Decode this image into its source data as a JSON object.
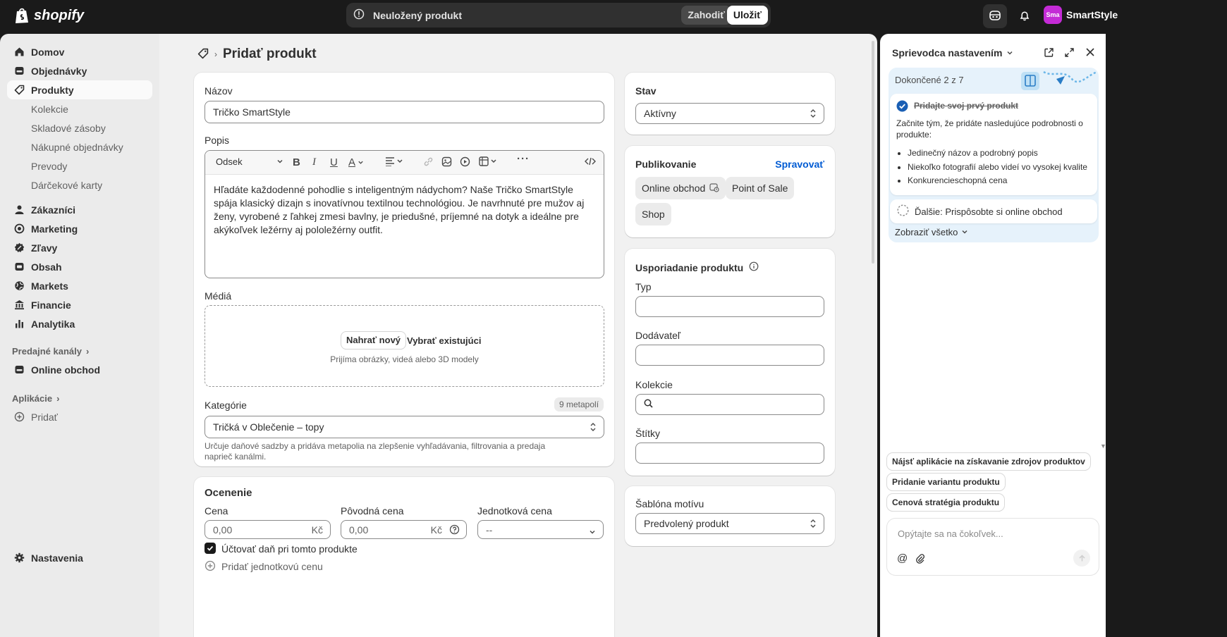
{
  "topbar": {
    "brand": "shopify",
    "unsaved_label": "Neuložený produkt",
    "discard_label": "Zahodiť",
    "save_label": "Uložiť",
    "store_initials": "Sma",
    "store_name": "SmartStyle"
  },
  "sidebar": {
    "items": [
      {
        "label": "Domov",
        "icon": "home-icon"
      },
      {
        "label": "Objednávky",
        "icon": "orders-icon"
      },
      {
        "label": "Produkty",
        "icon": "tag-icon",
        "active": true
      },
      {
        "label": "Zákazníci",
        "icon": "person-icon"
      },
      {
        "label": "Marketing",
        "icon": "target-icon"
      },
      {
        "label": "Zľavy",
        "icon": "discount-icon"
      },
      {
        "label": "Obsah",
        "icon": "content-icon"
      },
      {
        "label": "Markets",
        "icon": "globe-icon"
      },
      {
        "label": "Financie",
        "icon": "bank-icon"
      },
      {
        "label": "Analytika",
        "icon": "chart-icon"
      }
    ],
    "sub_items": [
      "Kolekcie",
      "Skladové zásoby",
      "Nákupné objednávky",
      "Prevody",
      "Dárčekové karty"
    ],
    "sales_channels_label": "Predajné kanály",
    "online_store_label": "Online obchod",
    "apps_label": "Aplikácie",
    "add_label": "Pridať",
    "settings_label": "Nastavenia"
  },
  "page": {
    "title": "Pridať produkt"
  },
  "product": {
    "name_label": "Názov",
    "name_value": "Tričko SmartStyle",
    "description_label": "Popis",
    "format_select": "Odsek",
    "description_text": "Hľadáte každodenné pohodlie s inteligentným nádychom? Naše Tričko SmartStyle spája klasický dizajn s inovatívnou textilnou technológiou. Je navrhnuté pre mužov aj ženy, vyrobené z ľahkej zmesi bavlny, je priedušné, príjemné na dotyk a ideálne pre akýkoľvek ležérny aj pololežérny outfit.",
    "media_label": "Médiá",
    "upload_new": "Nahrať nový",
    "select_existing": "Vybrať existujúci",
    "media_hint": "Prijíma obrázky, videá alebo 3D modely",
    "category_label": "Kategórie",
    "metafields_badge": "9 metapolí",
    "category_value": "Tričká v Oblečenie – topy",
    "category_help": "Určuje daňové sadzby a pridáva metapolia na zlepšenie vyhľadávania, filtrovania a predaja naprieč kanálmi."
  },
  "pricing": {
    "title": "Ocenenie",
    "price_label": "Cena",
    "price_value": "0,00",
    "compare_label": "Pôvodná cena",
    "compare_value": "0,00",
    "unit_label": "Jednotková cena",
    "unit_value": "--",
    "currency": "Kč",
    "charge_tax_label": "Účtovať daň pri tomto produkte",
    "add_unit_price_label": "Pridať jednotkovú cenu"
  },
  "status": {
    "title": "Stav",
    "value": "Aktívny"
  },
  "publishing": {
    "title": "Publikovanie",
    "manage": "Spravovať",
    "channels": [
      "Online obchod",
      "Point of Sale",
      "Shop"
    ]
  },
  "organization": {
    "title": "Usporiadanie produktu",
    "type_label": "Typ",
    "vendor_label": "Dodávateľ",
    "collections_label": "Kolekcie",
    "tags_label": "Štítky"
  },
  "theme_template": {
    "title": "Šablóna motívu",
    "value": "Predvolený produkt"
  },
  "guide": {
    "title": "Sprievodca nastavením",
    "progress": "Dokončené 2 z 7",
    "task_title": "Pridajte svoj prvý produkt",
    "task_intro": "Začnite tým, že pridáte nasledujúce podrobnosti o produkte:",
    "task_bullets": [
      "Jedinečný názov a podrobný popis",
      "Niekoľko fotografií alebo videí vo vysokej kvalite",
      "Konkurencieschopná cena"
    ],
    "next_task": "Ďalšie: Prispôsobte si online obchod",
    "show_all": "Zobraziť všetko",
    "suggestions": [
      "Nájsť aplikácie na získavanie zdrojov produktov",
      "Pridanie variantu produktu",
      "Cenová stratégia produktu"
    ],
    "chat_placeholder": "Opýtajte sa na čokoľvek..."
  }
}
